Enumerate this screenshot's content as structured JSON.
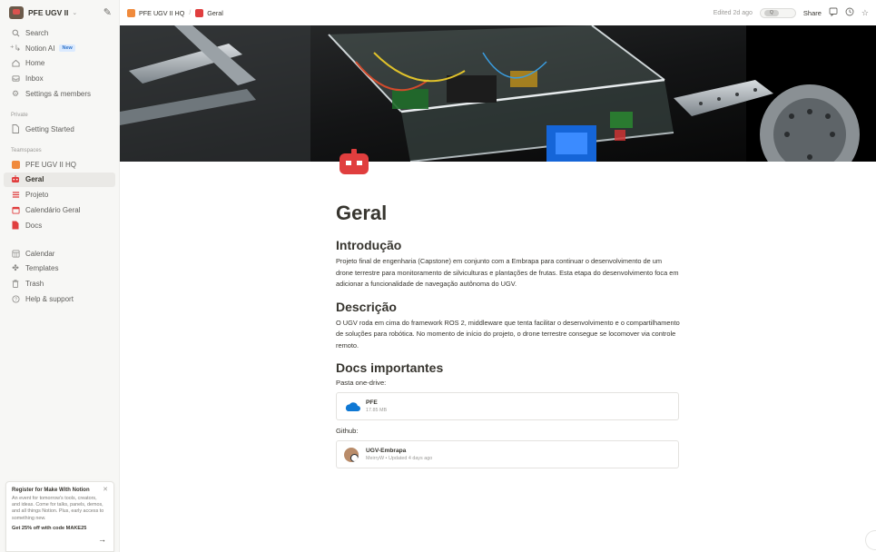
{
  "sidebar": {
    "workspace_name": "PFE UGV II",
    "nav": [
      {
        "label": "Search",
        "icon": "search-icon"
      },
      {
        "label": "Notion AI",
        "icon": "notion-ai-icon",
        "badge": "New"
      },
      {
        "label": "Home",
        "icon": "home-icon"
      },
      {
        "label": "Inbox",
        "icon": "inbox-icon"
      },
      {
        "label": "Settings & members",
        "icon": "gear-icon"
      }
    ],
    "private_label": "Private",
    "private_items": [
      {
        "label": "Getting Started",
        "icon": "page-icon"
      }
    ],
    "teamspaces_label": "Teamspaces",
    "teamspace_items": [
      {
        "label": "PFE UGV II HQ",
        "icon": "hq-icon"
      },
      {
        "label": "Geral",
        "icon": "robot-icon"
      },
      {
        "label": "Projeto",
        "icon": "list-icon"
      },
      {
        "label": "Calendário Geral",
        "icon": "calendar-icon"
      },
      {
        "label": "Docs",
        "icon": "doc-icon"
      }
    ],
    "bottom_items": [
      {
        "label": "Calendar",
        "icon": "calendar-grid-icon"
      },
      {
        "label": "Templates",
        "icon": "templates-icon"
      },
      {
        "label": "Trash",
        "icon": "trash-icon"
      },
      {
        "label": "Help & support",
        "icon": "help-icon"
      }
    ],
    "promo": {
      "title": "Register for Make With Notion",
      "body": "An event for tomorrow's tools, creators, and ideas. Come for talks, panels, demos, and all things Notion. Plus, early access to something new.",
      "cta": "Get 25% off with code MAKE25"
    }
  },
  "topbar": {
    "breadcrumb": [
      "PFE UGV II HQ",
      "Geral"
    ],
    "edited": "Edited 2d ago",
    "toggle_label": "Q",
    "share_label": "Share"
  },
  "page": {
    "title": "Geral",
    "sections": [
      {
        "heading": "Introdução",
        "text": "Projeto final de engenharia (Capstone) em conjunto com a Embrapa para continuar o desenvolvimento de um drone terrestre para monitoramento de silviculturas e plantações de frutas. Esta etapa do desenvolvimento foca em adicionar a funcionalidade de navegação autônoma do UGV."
      },
      {
        "heading": "Descrição",
        "text": "O UGV roda em cima do framework ROS 2, middleware que tenta facilitar o desenvolvimento e o compartilhamento de soluções para robótica. No momento de início do projeto, o drone terrestre consegue se locomover via controle remoto."
      }
    ],
    "docs_heading": "Docs importantes",
    "onedrive_label": "Pasta one-drive:",
    "onedrive_file": {
      "name": "PFE",
      "size": "17.85 MB"
    },
    "github_label": "Github:",
    "github_repo": {
      "name": "UGV-Embrapa",
      "meta": "MeirryW • Updated 4 days ago"
    }
  },
  "colors": {
    "accent_red": "#e03e3e",
    "onedrive_blue": "#0f78d4",
    "new_badge": "#2f73c9"
  }
}
